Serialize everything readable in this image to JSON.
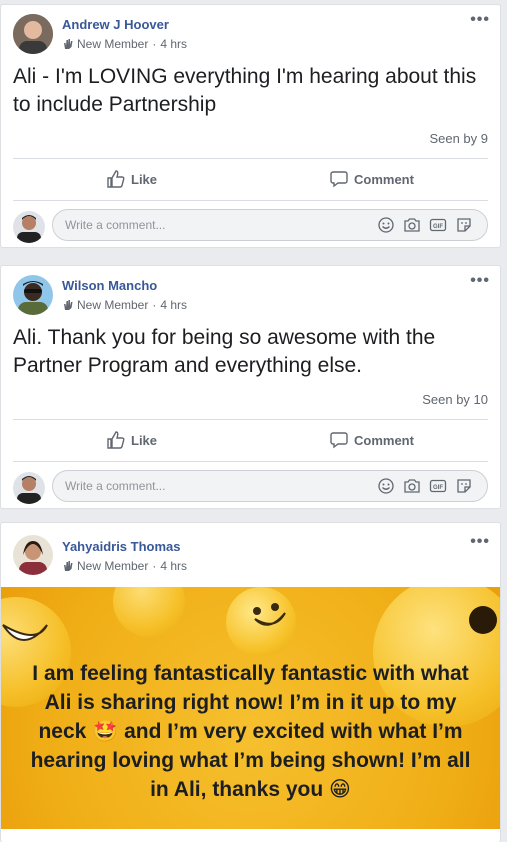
{
  "posts": [
    {
      "author": "Andrew J Hoover",
      "badge": "New Member",
      "time": "4 hrs",
      "text": "Ali - I'm LOVING everything I'm hearing about this to include Partnership",
      "seen": "Seen by 9"
    },
    {
      "author": "Wilson Mancho",
      "badge": "New Member",
      "time": "4 hrs",
      "text": "Ali. Thank you for being so awesome with the Partner Program and everything else.",
      "seen": "Seen by 10"
    },
    {
      "author": "Yahyaidris Thomas",
      "badge": "New Member",
      "time": "4 hrs",
      "text": "I am feeling fantastically fantastic with what Ali is sharing right now! I’m in it up to my neck 🤩 and I’m very excited with what I’m hearing loving what I’m being shown! I’m all in Ali, thanks you 😁"
    }
  ],
  "actions": {
    "like": "Like",
    "comment": "Comment"
  },
  "composer": {
    "placeholder": "Write a comment..."
  },
  "meta": {
    "separator": "·"
  },
  "icons": [
    "wave-icon",
    "thumbs-up-icon",
    "comment-bubble-icon",
    "emoji-icon",
    "camera-icon",
    "gif-icon",
    "sticker-icon",
    "more-icon"
  ],
  "colors": {
    "name": "#385898",
    "background": "#e9ebee",
    "post_bg_yellow": "#f0ae16"
  }
}
